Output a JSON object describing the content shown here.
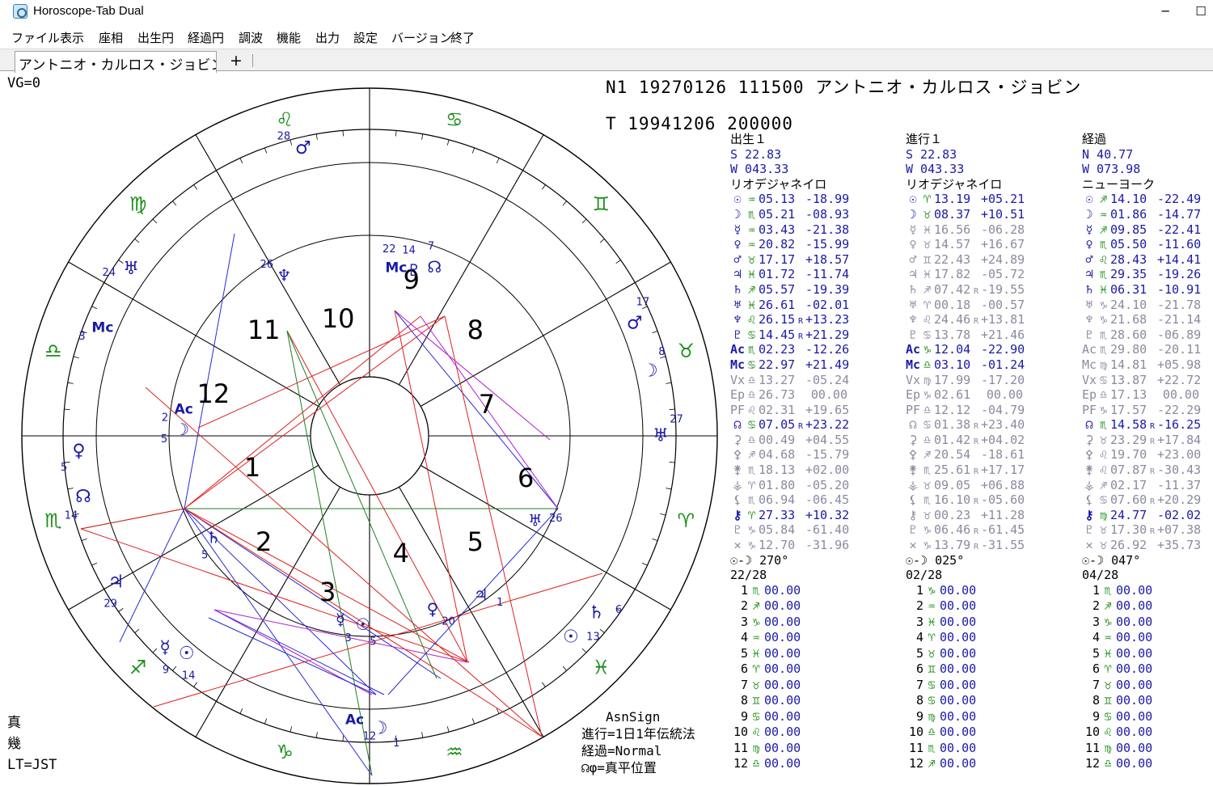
{
  "window": {
    "title": "Horoscope-Tab Dual",
    "minimize": "─",
    "maximize": "☐"
  },
  "menu": [
    "ファイル",
    "表示",
    "座相",
    "出生円",
    "経過円",
    "調波",
    "機能",
    "出力",
    "設定",
    "バージョン",
    "終了"
  ],
  "tabs": {
    "active": "アントニオ・カルロス・ジョビン",
    "add": "+"
  },
  "chart": {
    "vg": "VG=0",
    "n1_line": "N1 19270126 111500  アントニオ・カルロス・ジョビン",
    "t_line": "T  19941206 200000",
    "house_numbers": [
      "1",
      "2",
      "3",
      "4",
      "5",
      "6",
      "7",
      "8",
      "9",
      "10",
      "11",
      "12"
    ],
    "outer_signs": [
      "♏",
      "♐",
      "♑",
      "♒",
      "♓",
      "♈",
      "♉",
      "♊",
      "♋",
      "♌",
      "♍",
      "♎"
    ],
    "outer_planets": [
      {
        "glyph": "♂",
        "deg": "28"
      },
      {
        "glyph": "♅",
        "deg": "24"
      },
      {
        "glyph": "Mc",
        "deg": "3"
      },
      {
        "glyph": "♀",
        "deg": "5"
      },
      {
        "glyph": "☊",
        "deg": "14"
      },
      {
        "glyph": "♃",
        "deg": "29"
      },
      {
        "glyph": "☿",
        "deg": "9"
      },
      {
        "glyph": "☉",
        "deg": "14"
      },
      {
        "glyph": "Ac",
        "deg": "12"
      },
      {
        "glyph": "☽",
        "deg": "1"
      },
      {
        "glyph": "☉",
        "deg": "13"
      },
      {
        "glyph": "♄",
        "deg": "6"
      },
      {
        "glyph": "♅",
        "deg": "27"
      },
      {
        "glyph": "♂",
        "deg": "17"
      },
      {
        "glyph": "☽",
        "deg": "8"
      }
    ],
    "inner_planets": [
      {
        "glyph": "Mc",
        "deg": "22"
      },
      {
        "glyph": "♇",
        "deg": "14"
      },
      {
        "glyph": "☊",
        "deg": "7"
      },
      {
        "glyph": "♆",
        "deg": "26"
      },
      {
        "glyph": "Ac",
        "deg": "2"
      },
      {
        "glyph": "☽",
        "deg": "5"
      },
      {
        "glyph": "♄",
        "deg": "5"
      },
      {
        "glyph": "☿",
        "deg": "3"
      },
      {
        "glyph": "☉",
        "deg": "5"
      },
      {
        "glyph": "♀",
        "deg": "20"
      },
      {
        "glyph": "♃",
        "deg": "1"
      },
      {
        "glyph": "♅",
        "deg": "26"
      }
    ]
  },
  "columns": [
    {
      "title": "出生１",
      "lat": "S  22.83",
      "lon": "W 043.33",
      "place": "リオデジャネイロ",
      "rows": [
        {
          "g": "☉",
          "s": "♒",
          "d": "05.13",
          "r": "",
          "l": "-18.99"
        },
        {
          "g": "☽",
          "s": "♏",
          "d": "05.21",
          "r": "",
          "l": "-08.93"
        },
        {
          "g": "☿",
          "s": "♒",
          "d": "03.43",
          "r": "",
          "l": "-21.38"
        },
        {
          "g": "♀",
          "s": "♒",
          "d": "20.82",
          "r": "",
          "l": "-15.99"
        },
        {
          "g": "♂",
          "s": "♉",
          "d": "17.17",
          "r": "",
          "l": "+18.57"
        },
        {
          "g": "♃",
          "s": "♓",
          "d": "01.72",
          "r": "",
          "l": "-11.74"
        },
        {
          "g": "♄",
          "s": "♐",
          "d": "05.57",
          "r": "",
          "l": "-19.39"
        },
        {
          "g": "♅",
          "s": "♓",
          "d": "26.61",
          "r": "",
          "l": "-02.01"
        },
        {
          "g": "♆",
          "s": "♌",
          "d": "26.15",
          "r": "R",
          "l": "+13.23"
        },
        {
          "g": "♇",
          "s": "♋",
          "d": "14.45",
          "r": "R",
          "l": "+21.29"
        },
        {
          "g": "Ac",
          "s": "♏",
          "d": "02.23",
          "r": "",
          "l": "-12.26"
        },
        {
          "g": "Mc",
          "s": "♋",
          "d": "22.97",
          "r": "",
          "l": "+21.49"
        },
        {
          "g": "Vx",
          "s": "♎",
          "d": "13.27",
          "r": "",
          "l": "-05.24",
          "dim": true
        },
        {
          "g": "Ep",
          "s": "♎",
          "d": "26.73",
          "r": "",
          "l": "00.00",
          "dim": true
        },
        {
          "g": "PF",
          "s": "♌",
          "d": "02.31",
          "r": "",
          "l": "+19.65",
          "dim": true
        },
        {
          "g": "☊",
          "s": "♋",
          "d": "07.05",
          "r": "R",
          "l": "+23.22"
        },
        {
          "g": "⚳",
          "s": "♎",
          "d": "00.49",
          "r": "",
          "l": "+04.55",
          "dim": true
        },
        {
          "g": "⚴",
          "s": "♐",
          "d": "04.68",
          "r": "",
          "l": "-15.79",
          "dim": true
        },
        {
          "g": "⚵",
          "s": "♏",
          "d": "18.13",
          "r": "",
          "l": "+02.00",
          "dim": true
        },
        {
          "g": "⚶",
          "s": "♈",
          "d": "01.80",
          "r": "",
          "l": "-05.20",
          "dim": true
        },
        {
          "g": "⚸",
          "s": "♏",
          "d": "06.94",
          "r": "",
          "l": "-06.45",
          "dim": true
        },
        {
          "g": "⚷",
          "s": "♈",
          "d": "27.33",
          "r": "",
          "l": "+10.32"
        },
        {
          "g": "♇",
          "s": "♑",
          "d": "05.84",
          "r": "",
          "l": "-61.40",
          "dim": true
        },
        {
          "g": "✕",
          "s": "♑",
          "d": "12.70",
          "r": "",
          "l": "-31.96",
          "dim": true
        }
      ],
      "aspect": "☉-☽ 270°",
      "phase": "22/28",
      "houses": [
        {
          "n": "1",
          "s": "♏",
          "d": "00.00"
        },
        {
          "n": "2",
          "s": "♐",
          "d": "00.00"
        },
        {
          "n": "3",
          "s": "♑",
          "d": "00.00"
        },
        {
          "n": "4",
          "s": "♒",
          "d": "00.00"
        },
        {
          "n": "5",
          "s": "♓",
          "d": "00.00"
        },
        {
          "n": "6",
          "s": "♈",
          "d": "00.00"
        },
        {
          "n": "7",
          "s": "♉",
          "d": "00.00"
        },
        {
          "n": "8",
          "s": "♊",
          "d": "00.00"
        },
        {
          "n": "9",
          "s": "♋",
          "d": "00.00"
        },
        {
          "n": "10",
          "s": "♌",
          "d": "00.00"
        },
        {
          "n": "11",
          "s": "♍",
          "d": "00.00"
        },
        {
          "n": "12",
          "s": "♎",
          "d": "00.00"
        }
      ]
    },
    {
      "title": "進行１",
      "lat": "S  22.83",
      "lon": "W 043.33",
      "place": "リオデジャネイロ",
      "rows": [
        {
          "g": "☉",
          "s": "♈",
          "d": "13.19",
          "r": "",
          "l": "+05.21"
        },
        {
          "g": "☽",
          "s": "♉",
          "d": "08.37",
          "r": "",
          "l": "+10.51"
        },
        {
          "g": "☿",
          "s": "♓",
          "d": "16.56",
          "r": "",
          "l": "-06.28",
          "dim": true
        },
        {
          "g": "♀",
          "s": "♉",
          "d": "14.57",
          "r": "",
          "l": "+16.67",
          "dim": true
        },
        {
          "g": "♂",
          "s": "♊",
          "d": "22.43",
          "r": "",
          "l": "+24.89",
          "dim": true
        },
        {
          "g": "♃",
          "s": "♓",
          "d": "17.82",
          "r": "",
          "l": "-05.72",
          "dim": true
        },
        {
          "g": "♄",
          "s": "♐",
          "d": "07.42",
          "r": "R",
          "l": "-19.55",
          "dim": true
        },
        {
          "g": "♅",
          "s": "♈",
          "d": "00.18",
          "r": "",
          "l": "-00.57",
          "dim": true
        },
        {
          "g": "♆",
          "s": "♌",
          "d": "24.46",
          "r": "R",
          "l": "+13.81",
          "dim": true
        },
        {
          "g": "♇",
          "s": "♋",
          "d": "13.78",
          "r": "",
          "l": "+21.46",
          "dim": true
        },
        {
          "g": "Ac",
          "s": "♑",
          "d": "12.04",
          "r": "",
          "l": "-22.90"
        },
        {
          "g": "Mc",
          "s": "♎",
          "d": "03.10",
          "r": "",
          "l": "-01.24"
        },
        {
          "g": "Vx",
          "s": "♍",
          "d": "17.99",
          "r": "",
          "l": "-17.20",
          "dim": true
        },
        {
          "g": "Ep",
          "s": "♑",
          "d": "02.61",
          "r": "",
          "l": "00.00",
          "dim": true
        },
        {
          "g": "PF",
          "s": "♎",
          "d": "12.12",
          "r": "",
          "l": "-04.79",
          "dim": true
        },
        {
          "g": "☊",
          "s": "♋",
          "d": "01.38",
          "r": "R",
          "l": "+23.40",
          "dim": true
        },
        {
          "g": "⚳",
          "s": "♎",
          "d": "01.42",
          "r": "R",
          "l": "+04.02",
          "dim": true
        },
        {
          "g": "⚴",
          "s": "♐",
          "d": "20.54",
          "r": "",
          "l": "-18.61",
          "dim": true
        },
        {
          "g": "⚵",
          "s": "♏",
          "d": "25.61",
          "r": "R",
          "l": "+17.17",
          "dim": true
        },
        {
          "g": "⚶",
          "s": "♉",
          "d": "09.05",
          "r": "",
          "l": "+06.88",
          "dim": true
        },
        {
          "g": "⚸",
          "s": "♏",
          "d": "16.10",
          "r": "R",
          "l": "-05.60",
          "dim": true
        },
        {
          "g": "⚷",
          "s": "♉",
          "d": "00.23",
          "r": "",
          "l": "+11.28",
          "dim": true
        },
        {
          "g": "♇",
          "s": "♑",
          "d": "06.46",
          "r": "R",
          "l": "-61.45",
          "dim": true
        },
        {
          "g": "✕",
          "s": "♑",
          "d": "13.79",
          "r": "R",
          "l": "-31.55",
          "dim": true
        }
      ],
      "aspect": "☉-☽ 025°",
      "phase": "02/28",
      "houses": [
        {
          "n": "1",
          "s": "♑",
          "d": "00.00"
        },
        {
          "n": "2",
          "s": "♒",
          "d": "00.00"
        },
        {
          "n": "3",
          "s": "♓",
          "d": "00.00"
        },
        {
          "n": "4",
          "s": "♈",
          "d": "00.00"
        },
        {
          "n": "5",
          "s": "♉",
          "d": "00.00"
        },
        {
          "n": "6",
          "s": "♊",
          "d": "00.00"
        },
        {
          "n": "7",
          "s": "♋",
          "d": "00.00"
        },
        {
          "n": "8",
          "s": "♋",
          "d": "00.00"
        },
        {
          "n": "9",
          "s": "♍",
          "d": "00.00"
        },
        {
          "n": "10",
          "s": "♎",
          "d": "00.00"
        },
        {
          "n": "11",
          "s": "♏",
          "d": "00.00"
        },
        {
          "n": "12",
          "s": "♐",
          "d": "00.00"
        }
      ]
    },
    {
      "title": "経過",
      "lat": "N  40.77",
      "lon": "W 073.98",
      "place": "ニューヨーク",
      "rows": [
        {
          "g": "☉",
          "s": "♐",
          "d": "14.10",
          "r": "",
          "l": "-22.49"
        },
        {
          "g": "☽",
          "s": "♒",
          "d": "01.86",
          "r": "",
          "l": "-14.77"
        },
        {
          "g": "☿",
          "s": "♐",
          "d": "09.85",
          "r": "",
          "l": "-22.41"
        },
        {
          "g": "♀",
          "s": "♏",
          "d": "05.50",
          "r": "",
          "l": "-11.60"
        },
        {
          "g": "♂",
          "s": "♌",
          "d": "28.43",
          "r": "",
          "l": "+14.41"
        },
        {
          "g": "♃",
          "s": "♏",
          "d": "29.35",
          "r": "",
          "l": "-19.26"
        },
        {
          "g": "♄",
          "s": "♓",
          "d": "06.31",
          "r": "",
          "l": "-10.91"
        },
        {
          "g": "♅",
          "s": "♑",
          "d": "24.10",
          "r": "",
          "l": "-21.78",
          "dim": true
        },
        {
          "g": "♆",
          "s": "♑",
          "d": "21.68",
          "r": "",
          "l": "-21.14",
          "dim": true
        },
        {
          "g": "♇",
          "s": "♏",
          "d": "28.60",
          "r": "",
          "l": "-06.89",
          "dim": true
        },
        {
          "g": "Ac",
          "s": "♏",
          "d": "29.80",
          "r": "",
          "l": "-20.11",
          "dim": true
        },
        {
          "g": "Mc",
          "s": "♍",
          "d": "14.81",
          "r": "",
          "l": "+05.98",
          "dim": true
        },
        {
          "g": "Vx",
          "s": "♋",
          "d": "13.87",
          "r": "",
          "l": "+22.72",
          "dim": true
        },
        {
          "g": "Ep",
          "s": "♎",
          "d": "17.13",
          "r": "",
          "l": "00.00",
          "dim": true
        },
        {
          "g": "PF",
          "s": "♑",
          "d": "17.57",
          "r": "",
          "l": "-22.29",
          "dim": true
        },
        {
          "g": "☊",
          "s": "♏",
          "d": "14.58",
          "r": "R",
          "l": "-16.25"
        },
        {
          "g": "⚳",
          "s": "♉",
          "d": "23.29",
          "r": "R",
          "l": "+17.84",
          "dim": true
        },
        {
          "g": "⚴",
          "s": "♌",
          "d": "19.70",
          "r": "",
          "l": "+23.00",
          "dim": true
        },
        {
          "g": "⚵",
          "s": "♌",
          "d": "07.87",
          "r": "R",
          "l": "-30.43",
          "dim": true
        },
        {
          "g": "⚶",
          "s": "♐",
          "d": "02.17",
          "r": "",
          "l": "-11.37",
          "dim": true
        },
        {
          "g": "⚸",
          "s": "♋",
          "d": "07.60",
          "r": "R",
          "l": "+20.29",
          "dim": true
        },
        {
          "g": "⚷",
          "s": "♍",
          "d": "24.77",
          "r": "",
          "l": "-02.02"
        },
        {
          "g": "♇",
          "s": "♉",
          "d": "17.30",
          "r": "R",
          "l": "+07.38",
          "dim": true
        },
        {
          "g": "✕",
          "s": "♉",
          "d": "26.92",
          "r": "",
          "l": "+35.73",
          "dim": true
        }
      ],
      "aspect": "☉-☽ 047°",
      "phase": "04/28",
      "houses": [
        {
          "n": "1",
          "s": "♏",
          "d": "00.00"
        },
        {
          "n": "2",
          "s": "♐",
          "d": "00.00"
        },
        {
          "n": "3",
          "s": "♑",
          "d": "00.00"
        },
        {
          "n": "4",
          "s": "♒",
          "d": "00.00"
        },
        {
          "n": "5",
          "s": "♓",
          "d": "00.00"
        },
        {
          "n": "6",
          "s": "♈",
          "d": "00.00"
        },
        {
          "n": "7",
          "s": "♉",
          "d": "00.00"
        },
        {
          "n": "8",
          "s": "♊",
          "d": "00.00"
        },
        {
          "n": "9",
          "s": "♋",
          "d": "00.00"
        },
        {
          "n": "10",
          "s": "♌",
          "d": "00.00"
        },
        {
          "n": "11",
          "s": "♍",
          "d": "00.00"
        },
        {
          "n": "12",
          "s": "♎",
          "d": "00.00"
        }
      ]
    }
  ],
  "footer_left": [
    "真",
    "幾",
    "LT=JST"
  ],
  "footer_mid": [
    "AsnSign",
    "進行=1日1年伝統法",
    "経過=Normal",
    "☊φ=真平位置"
  ],
  "colors": {
    "sign": "#1a8f1a",
    "planet": "#1a1aa6",
    "aspect_red": "#e02020",
    "aspect_blue": "#2a2ad0",
    "aspect_purple": "#b020d0",
    "aspect_green": "#208020"
  }
}
